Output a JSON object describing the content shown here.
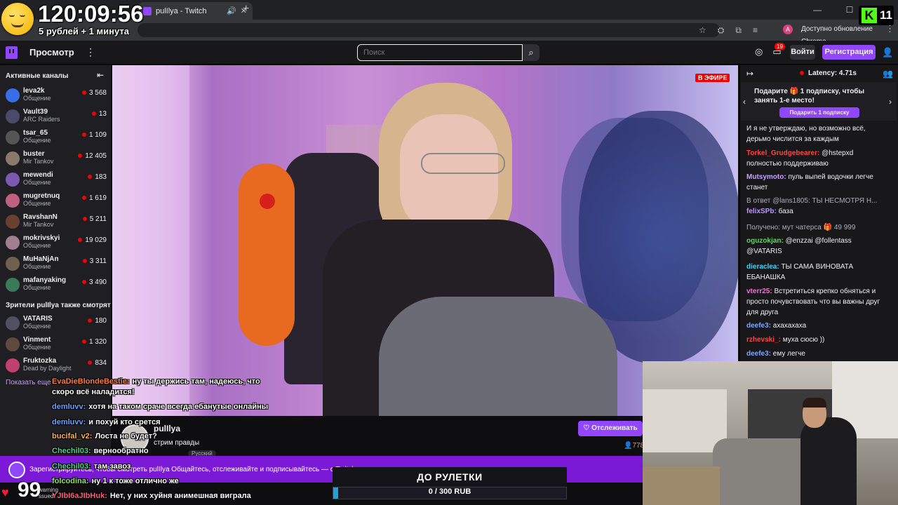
{
  "browser": {
    "tab_title": "pulIlya - Twitch",
    "update_label": "Доступно обновление Chrome",
    "profile_initial": "A"
  },
  "overlay": {
    "timer": "120:09:56",
    "rate": "5 рублей + 1 минута",
    "kick_count": "11",
    "kick_letter": "K",
    "heart_count": "99",
    "warn_text": "warning",
    "warn_text2": "ssued"
  },
  "nav": {
    "browse": "Просмотр",
    "search_placeholder": "Поиск",
    "notifications": "19",
    "login": "Войти",
    "signup": "Регистрация"
  },
  "sidebar": {
    "active_header": "Активные каналы",
    "also_header": "Зрители pulIlya также смотрят",
    "show_more": "Показать еще",
    "channels": [
      {
        "name": "leva2k",
        "category": "Общение",
        "viewers": "3 568",
        "color": "#3a6ee8"
      },
      {
        "name": "Vault39",
        "category": "ARC Raiders",
        "viewers": "13",
        "color": "#4a4a6a"
      },
      {
        "name": "tsar_65",
        "category": "Общение",
        "viewers": "1 109",
        "color": "#555"
      },
      {
        "name": "buster",
        "category": "Mir Tankov",
        "viewers": "12 405",
        "color": "#8a7a6a"
      },
      {
        "name": "mewendi",
        "category": "Общение",
        "viewers": "183",
        "color": "#7a5ab0"
      },
      {
        "name": "mugretnuq",
        "category": "Общение",
        "viewers": "1 619",
        "color": "#c06080"
      },
      {
        "name": "RavshanN",
        "category": "Mir Tankov",
        "viewers": "5 211",
        "color": "#6a4030"
      },
      {
        "name": "mokrivskyi",
        "category": "Общение",
        "viewers": "19 029",
        "color": "#a08090"
      },
      {
        "name": "MuHaNjAn",
        "category": "Общение",
        "viewers": "3 311",
        "color": "#706050"
      },
      {
        "name": "mafanyaking",
        "category": "Общение",
        "viewers": "3 490",
        "color": "#3a7a5a"
      }
    ],
    "also": [
      {
        "name": "VATARIS",
        "category": "Общение",
        "viewers": "180",
        "color": "#505060"
      },
      {
        "name": "Vinment",
        "category": "Общение",
        "viewers": "1 320",
        "color": "#604a40"
      },
      {
        "name": "Fruktozka",
        "category": "Dead by Daylight",
        "viewers": "834",
        "color": "#c04070"
      }
    ]
  },
  "stream": {
    "live_badge": "В ЭФИРЕ",
    "streamer": "pulIlya",
    "title": "стрим правды",
    "tag": "Русский",
    "follow": "Отслеживать",
    "viewers": "778"
  },
  "banner": {
    "text": "Зарегистрируйтесь, чтобы смотреть pulIlya  Общайтесь, отслеживайте и подписывайтесь — с Twitch все в ваших руках."
  },
  "overlay_chat": [
    {
      "user": "EvaDieBlondeBestie:",
      "text": "ну ты держись там, надеюсь, что",
      "color": "#ff7c3a"
    },
    {
      "user": "",
      "text": "скоро всё наладится!",
      "color": "#fff"
    },
    {
      "user": "demluvv:",
      "text": "хотя на таком сраче всегда ебанутые онлайны",
      "color": "#6aa4ff"
    },
    {
      "user": "demluvv:",
      "text": "и похуй кто срется",
      "color": "#6aa4ff"
    },
    {
      "user": "bucifal_v2:",
      "text": "Лоста не будет?",
      "color": "#ffb347"
    },
    {
      "user": "Chechil03:",
      "text": "вернообратно",
      "color": "#4fd18b"
    },
    {
      "user": "Chechil03:",
      "text": "там завоз",
      "color": "#4fd18b"
    },
    {
      "user": "folcodina:",
      "text": "ну 1 к тоже отлично же",
      "color": "#8fe36a"
    },
    {
      "user": "YJIbI6aJIbHuk:",
      "text": "Нет, у них хуйня анимешная виграла",
      "color": "#ff5a7a"
    }
  ],
  "roulette": {
    "title": "ДО РУЛЕТКИ",
    "value": "0 / 300 RUB",
    "progress": 0.02
  },
  "chat": {
    "latency": "Latency: 4.71s",
    "gift_text": "Подарите 🎁 1 подписку, чтобы занять 1-е место!",
    "gift_button": "Подарить 1 подписку",
    "messages": [
      {
        "user": "",
        "text": "И я не утверждаю, но возможно всё, дерьмо числится за каждым",
        "color": "#efeff1"
      },
      {
        "user": "Torkel_Grudgebearer:",
        "text": "@hstepxd полностью поддерживаю",
        "color": "#ff4545"
      },
      {
        "user": "Mutsymoto:",
        "text": "пуль выпей водочки легче станет",
        "color": "#c9a0ff"
      },
      {
        "user": "",
        "text": "В ответ @lans1805: ТЫ НЕСМОТРЯ Н...",
        "color": "#adadb8"
      },
      {
        "user": "felixSPb:",
        "text": "база",
        "color": "#bf94ff"
      },
      {
        "user": "",
        "text": "Получено: мут чатерса 🎁 49 999",
        "color": "#adadb8"
      },
      {
        "user": "oguzokjan:",
        "text": "@enzzai @follentass @VATARIS",
        "color": "#5cd65c"
      },
      {
        "user": "dieraclea:",
        "text": "ТЫ САМА ВИНОВАТА ЕБАНАШКА",
        "color": "#4ad0ff"
      },
      {
        "user": "vterr25:",
        "text": "Встретиться крепко обняться и просто почувствовать что вы важны друг для друга",
        "color": "#ff6ad5"
      },
      {
        "user": "deefe3:",
        "text": "ахахахаха",
        "color": "#7aa8ff"
      },
      {
        "user": "rzhevski_:",
        "text": "муха сюсю ))",
        "color": "#ff4545"
      },
      {
        "user": "deefe3:",
        "text": "ему легче",
        "color": "#7aa8ff"
      }
    ]
  }
}
